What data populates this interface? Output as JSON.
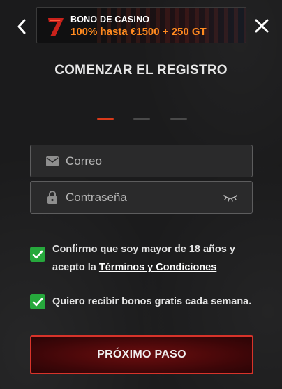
{
  "banner": {
    "logo": "7",
    "title": "BONO DE CASINO",
    "offer": "100% hasta €1500 + 250 GT"
  },
  "nav": {
    "back_icon": "chevron-left-icon",
    "close_icon": "close-icon"
  },
  "heading": "COMENZAR EL REGISTRO",
  "steps": {
    "total": 3,
    "current": 1,
    "active_color": "#d93a1a"
  },
  "form": {
    "email_placeholder": "Correo",
    "email_value": "",
    "password_placeholder": "Contraseña",
    "password_value": ""
  },
  "consents": {
    "age_line1": "Confirmo que soy mayor de 18 años y",
    "age_line2_prefix": "acepto la",
    "age_terms_link": "Términos y Condiciones",
    "age_checked": true,
    "bonus_text": "Quiero recibir bonos gratis cada semana.",
    "bonus_checked": true,
    "check_color": "#26a83c"
  },
  "next_button": "PRÓXIMO PASO",
  "colors": {
    "accent": "#d8332a",
    "offer": "#ff8a1f",
    "background": "#1b1b1c"
  }
}
